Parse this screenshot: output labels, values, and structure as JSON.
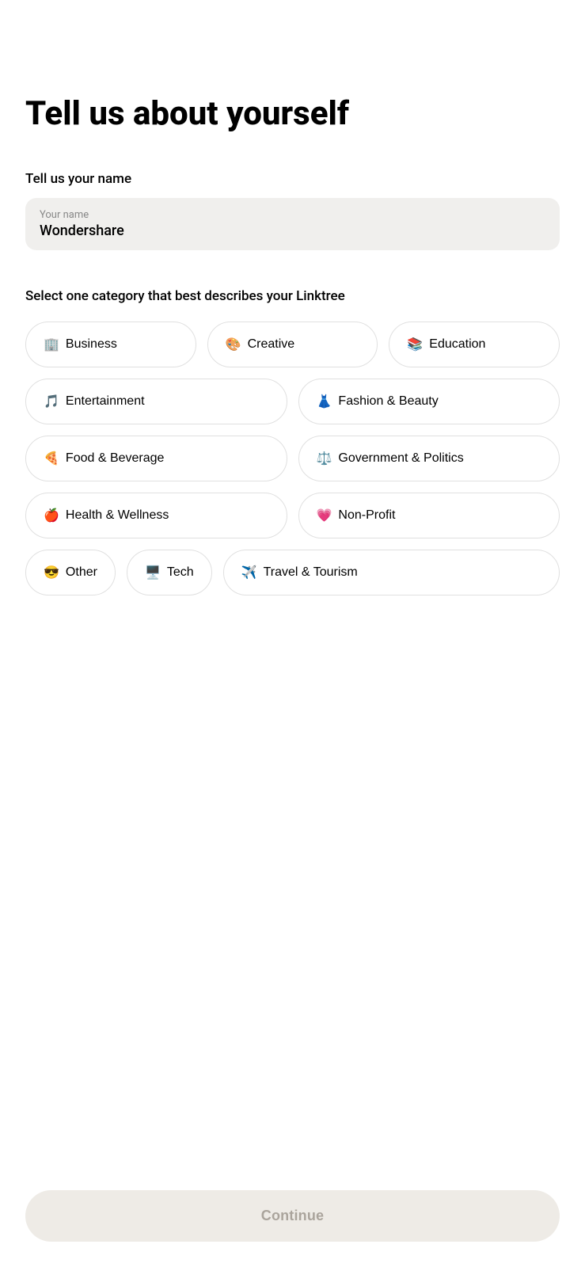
{
  "page": {
    "title": "Tell us about yourself",
    "name_section": {
      "label": "Tell us your name",
      "input_placeholder": "Your name",
      "input_value": "Wondershare"
    },
    "category_section": {
      "label": "Select one category that best describes your Linktree",
      "categories": [
        {
          "id": "business",
          "emoji": "🏢",
          "label": "Business"
        },
        {
          "id": "creative",
          "emoji": "🎨",
          "label": "Creative"
        },
        {
          "id": "education",
          "emoji": "📚",
          "label": "Education"
        },
        {
          "id": "entertainment",
          "emoji": "🎵",
          "label": "Entertainment"
        },
        {
          "id": "fashion-beauty",
          "emoji": "👗",
          "label": "Fashion & Beauty"
        },
        {
          "id": "food-beverage",
          "emoji": "🍕",
          "label": "Food & Beverage"
        },
        {
          "id": "government-politics",
          "emoji": "⚖️",
          "label": "Government & Politics"
        },
        {
          "id": "health-wellness",
          "emoji": "🍎",
          "label": "Health & Wellness"
        },
        {
          "id": "non-profit",
          "emoji": "💗",
          "label": "Non-Profit"
        },
        {
          "id": "other",
          "emoji": "😎",
          "label": "Other"
        },
        {
          "id": "tech",
          "emoji": "🖥️",
          "label": "Tech"
        },
        {
          "id": "travel-tourism",
          "emoji": "✈️",
          "label": "Travel & Tourism"
        }
      ]
    },
    "continue_button": {
      "label": "Continue"
    }
  }
}
